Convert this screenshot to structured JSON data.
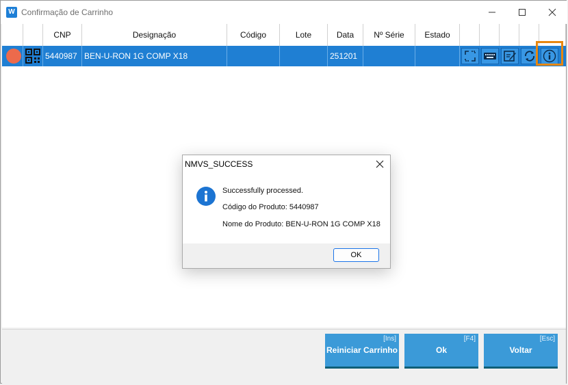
{
  "window": {
    "title": "Confirmação de Carrinho",
    "logo_text": "W"
  },
  "table": {
    "columns": [
      "",
      "",
      "CNP",
      "Designação",
      "Código",
      "Lote",
      "Data",
      "Nº Série",
      "Estado"
    ],
    "rows": [
      {
        "status_color": "#ec6a4c",
        "cnp": "5440987",
        "designacao": "BEN-U-RON 1G COMP X18",
        "codigo": "",
        "lote": "",
        "data": "251201",
        "numero_serie": "",
        "estado": ""
      }
    ],
    "row_actions": [
      "swap-icon",
      "keyboard-icon",
      "edit-icon",
      "refresh-icon",
      "info-icon"
    ],
    "selected_color": "#1f7fd3",
    "highlight_color": "#e8870f"
  },
  "dialog": {
    "title": "NMVS_SUCCESS",
    "icon": "info-icon",
    "message": "Successfully processed.",
    "product_code": "Código do Produto: 5440987",
    "product_name": "Nome do Produto: BEN-U-RON 1G COMP X18",
    "ok_label": "OK"
  },
  "actions": [
    {
      "label": "Reiniciar Carrinho",
      "key": "[Ins]"
    },
    {
      "label": "Ok",
      "key": "[F4]"
    },
    {
      "label": "Voltar",
      "key": "[Esc]"
    }
  ],
  "colors": {
    "accent": "#3b9ad8",
    "accent_dark": "#0f5f77"
  }
}
